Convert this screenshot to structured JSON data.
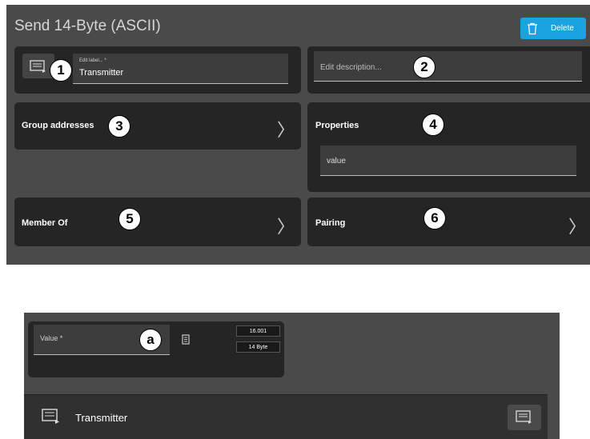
{
  "header": {
    "title": "Send 14-Byte (ASCII)",
    "delete_label": "Delete"
  },
  "label_card": {
    "small_label": "Edit label... *",
    "value": "Transmitter"
  },
  "description_card": {
    "placeholder": "Edit description..."
  },
  "group_addresses": {
    "label": "Group addresses"
  },
  "properties": {
    "label": "Properties",
    "value_field": "value"
  },
  "member_of": {
    "label": "Member Of"
  },
  "pairing": {
    "label": "Pairing"
  },
  "chevron": "〉",
  "callouts": [
    "1",
    "2",
    "3",
    "4",
    "5",
    "6",
    "a"
  ],
  "bottom": {
    "value_placeholder": "Value *",
    "dpt": "16.001",
    "size": "14 Byte",
    "row_label": "Transmitter"
  },
  "colors": {
    "panel_bg": "#4a4a4a",
    "card_bg": "#252525",
    "accent": "#1aa3e0"
  }
}
